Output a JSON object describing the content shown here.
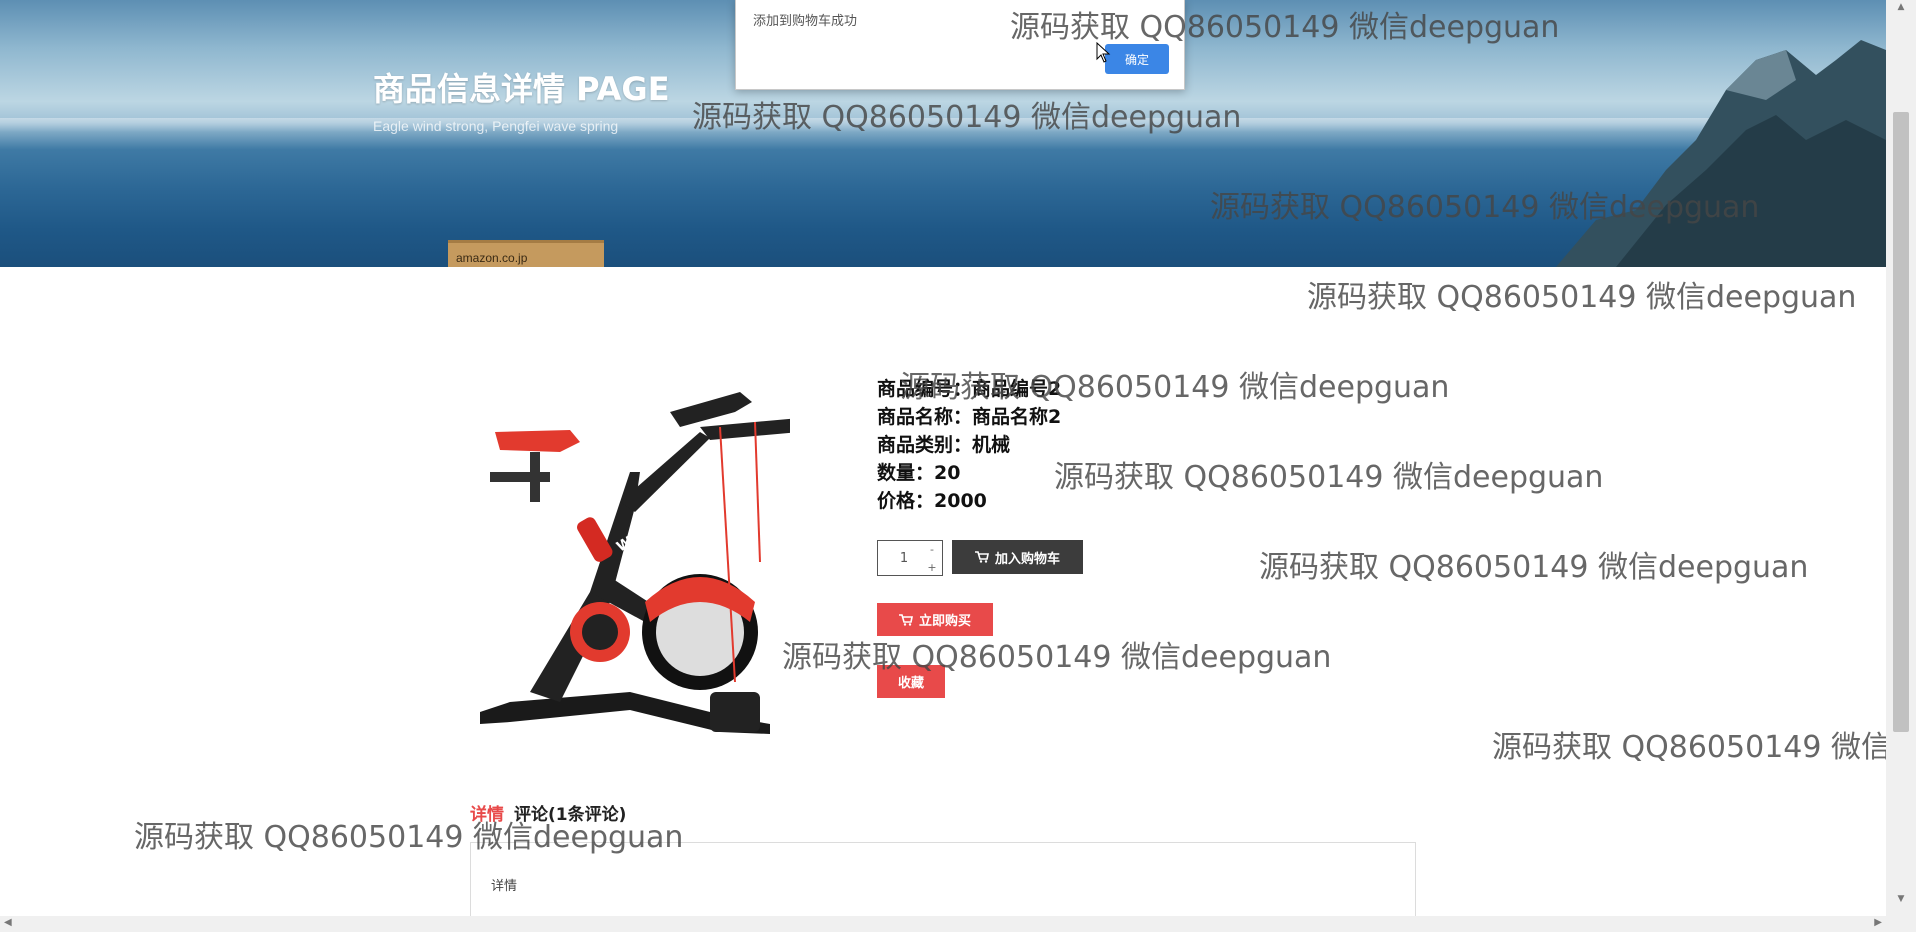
{
  "banner": {
    "title": "商品信息详情 PAGE",
    "subtitle": "Eagle wind strong, Pengfei wave spring",
    "box_text": "amazon.co.jp"
  },
  "dialog": {
    "message": "添加到购物车成功",
    "ok_label": "确定"
  },
  "product": {
    "image_alt": "exercise bike",
    "code": "商品编号：商品编号2",
    "name": "商品名称：商品名称2",
    "category": "商品类别：机械",
    "quantity": "数量：20",
    "price": "价格：2000"
  },
  "purchase": {
    "qty_value": "1",
    "qty_up": "+",
    "qty_down": "-",
    "add_cart_label": "加入购物车",
    "buy_now_label": "立即购买",
    "favorite_label": "收藏"
  },
  "tabs": [
    {
      "label": "详情"
    },
    {
      "label": "评论(1条评论)"
    }
  ],
  "detail_panel": {
    "text": "详情"
  },
  "watermark": "源码获取 QQ86050149 微信deepguan",
  "colors": {
    "accent_red": "#e84a4a",
    "dark_button": "#3c3c3c",
    "dialog_ok_blue": "#3b86e6"
  }
}
